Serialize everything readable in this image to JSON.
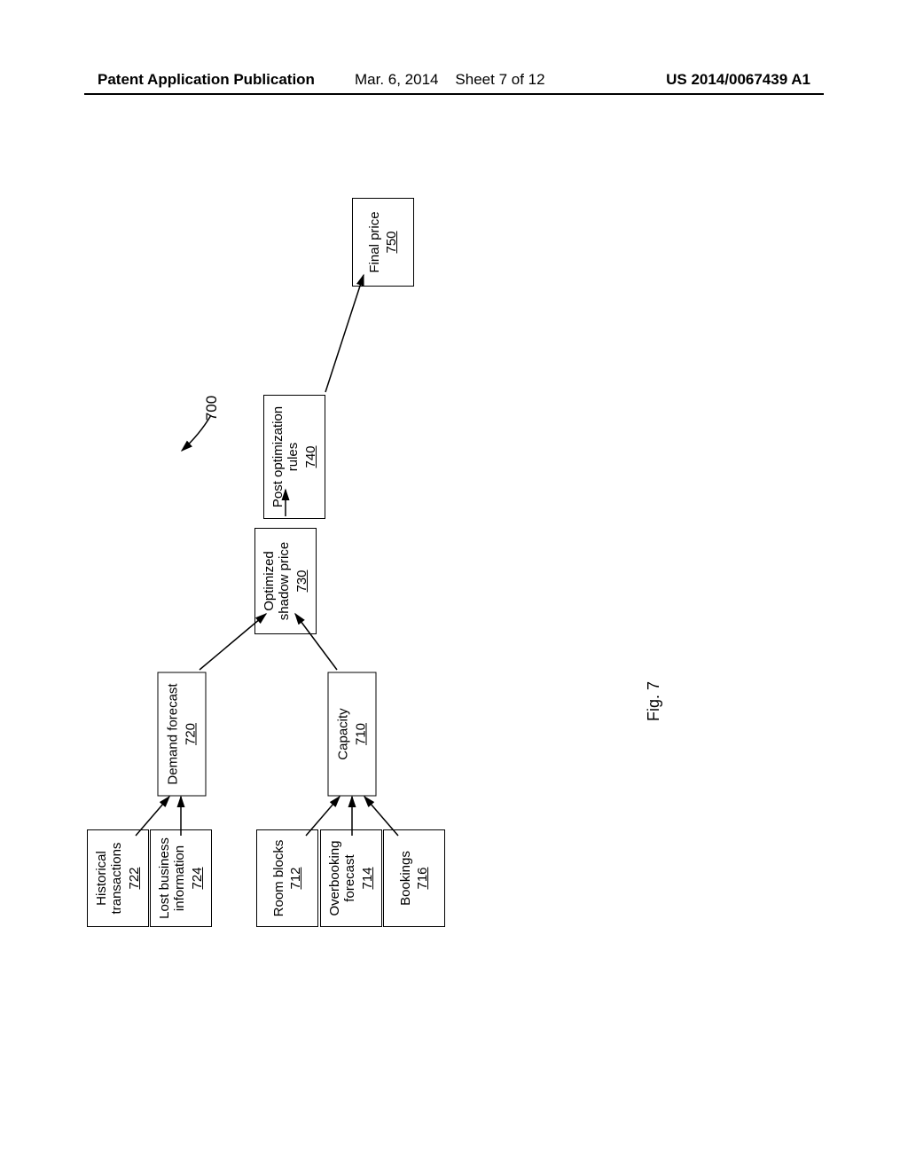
{
  "header": {
    "left": "Patent Application Publication",
    "mid_date": "Mar. 6, 2014",
    "mid_sheet": "Sheet 7 of 12",
    "right": "US 2014/0067439 A1"
  },
  "flow_ref": "700",
  "fig_label": "Fig. 7",
  "boxes": {
    "b722": {
      "label": "Historical transactions",
      "ref": "722"
    },
    "b724": {
      "label": "Lost business information",
      "ref": "724"
    },
    "b712": {
      "label": "Room blocks",
      "ref": "712"
    },
    "b714": {
      "label": "Overbooking forecast",
      "ref": "714"
    },
    "b716": {
      "label": "Bookings",
      "ref": "716"
    },
    "b720": {
      "label": "Demand forecast",
      "ref": "720"
    },
    "b710": {
      "label": "Capacity",
      "ref": "710"
    },
    "b730": {
      "label": "Optimized shadow price",
      "ref": "730"
    },
    "b740": {
      "label": "Post optimization rules",
      "ref": "740"
    },
    "b750": {
      "label": "Final price",
      "ref": "750"
    }
  }
}
